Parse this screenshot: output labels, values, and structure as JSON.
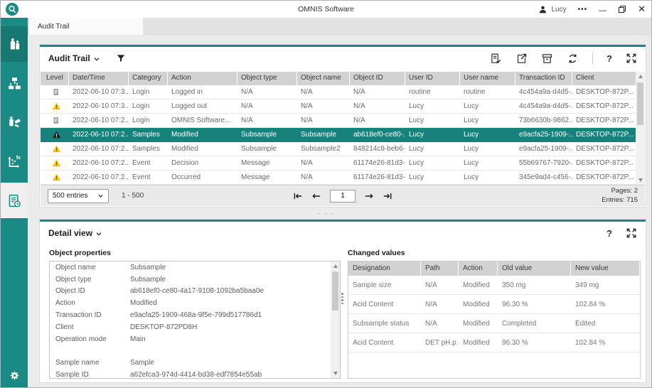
{
  "window": {
    "title": "OMNIS Software",
    "user": "Lucy",
    "controls": {
      "minimize": "—",
      "close": "✕"
    }
  },
  "icons": {
    "ellipsis": "•••",
    "help": "?",
    "divider_dots": "· · ·"
  },
  "tab": {
    "label": "Audit Trail"
  },
  "sidebar": {
    "items": [
      "samples",
      "structure",
      "sample-handling",
      "analysis",
      "audit-trail"
    ],
    "active_item": "audit-trail"
  },
  "colors": {
    "accent": "#1b8a84",
    "warning": "#f7c600",
    "selected_row": "#17827b"
  },
  "audit_panel": {
    "title": "Audit Trail",
    "columns": [
      "Level",
      "Date/Time",
      "Category",
      "Action",
      "Object type",
      "Object name",
      "Object ID",
      "User ID",
      "User name",
      "Transaction ID",
      "Client"
    ],
    "rows": [
      {
        "level": "info",
        "selected": false,
        "cells": [
          "2022-06-10 07:3...",
          "Login",
          "Logged in",
          "N/A",
          "N/A",
          "N/A",
          "routine",
          "routine",
          "4c454a9a-d4d5-...",
          "DESKTOP-872P..."
        ]
      },
      {
        "level": "warning",
        "selected": false,
        "cells": [
          "2022-06-10 07:3...",
          "Login",
          "Logged out",
          "N/A",
          "N/A",
          "N/A",
          "Lucy",
          "Lucy",
          "4c454a9a-d4d5-...",
          "DESKTOP-872P..."
        ]
      },
      {
        "level": "info",
        "selected": false,
        "cells": [
          "2022-06-10 07:2...",
          "Login",
          "OMNIS Software...",
          "N/A",
          "N/A",
          "N/A",
          "Lucy",
          "Lucy",
          "73b6630b-9862...",
          "DESKTOP-872P..."
        ]
      },
      {
        "level": "warning",
        "selected": true,
        "cells": [
          "2022-06-10 07:2...",
          "Samples",
          "Modified",
          "Subsample",
          "Subsample",
          "ab618ef0-ce80-...",
          "Lucy",
          "Lucy",
          "e9acfa25-1909-...",
          "DESKTOP-872P..."
        ]
      },
      {
        "level": "warning",
        "selected": false,
        "cells": [
          "2022-06-10 07:2...",
          "Samples",
          "Modified",
          "Subsample",
          "Subsample2",
          "848214c8-beb6-...",
          "Lucy",
          "Lucy",
          "e9acfa25-1909-...",
          "DESKTOP-872P..."
        ]
      },
      {
        "level": "warning",
        "selected": false,
        "cells": [
          "2022-06-10 07:2...",
          "Event",
          "Decision",
          "Message",
          "N/A",
          "61174e26-81d3-...",
          "Lucy",
          "Lucy",
          "55b69767-7920-...",
          "DESKTOP-872P..."
        ]
      },
      {
        "level": "warning",
        "selected": false,
        "cells": [
          "2022-06-10 07:2...",
          "Event",
          "Occurred",
          "Message",
          "N/A",
          "61174e26-81d3-...",
          "Lucy",
          "Lucy",
          "345e9ad4-c456-...",
          "DESKTOP-872P..."
        ]
      }
    ],
    "pagination": {
      "size_label": "500 entries",
      "range": "1 - 500",
      "current_page": "1",
      "pages_label": "Pages: 2",
      "entries_label": "Entries: 715"
    }
  },
  "detail_panel": {
    "title": "Detail view",
    "object_properties": {
      "label": "Object properties",
      "rows": [
        {
          "label": "Object name",
          "value": "Subsample"
        },
        {
          "label": "Object type",
          "value": "Subsample"
        },
        {
          "label": "Object ID",
          "value": "ab618ef0-ce80-4a17-9108-1092ba5baa0e"
        },
        {
          "label": "Action",
          "value": "Modified"
        },
        {
          "label": "Transaction ID",
          "value": "e9acfa25-1909-468a-9f5e-799d517786d1"
        },
        {
          "label": "Client",
          "value": "DESKTOP-872PD8H"
        },
        {
          "label": "Operation mode",
          "value": "Main"
        },
        {
          "label": "",
          "value": ""
        },
        {
          "label": "Sample name",
          "value": "Sample"
        },
        {
          "label": "Sample ID",
          "value": "a62efca3-974d-4414-bd38-edf7854e55ab"
        }
      ]
    },
    "changed_values": {
      "label": "Changed values",
      "columns": [
        "Designation",
        "Path",
        "Action",
        "Old value",
        "New value"
      ],
      "rows": [
        [
          "Sample size",
          "N/A",
          "Modified",
          "350 mg",
          "349 mg"
        ],
        [
          "Acid Content",
          "N/A",
          "Modified",
          "96.30 %",
          "102.84 %"
        ],
        [
          "Subsample status",
          "N/A",
          "Modified",
          "Completed",
          "Edited"
        ],
        [
          "Acid Content",
          "DET pH.p...",
          "Modified",
          "96.30 %",
          "102.84 %"
        ]
      ]
    }
  }
}
